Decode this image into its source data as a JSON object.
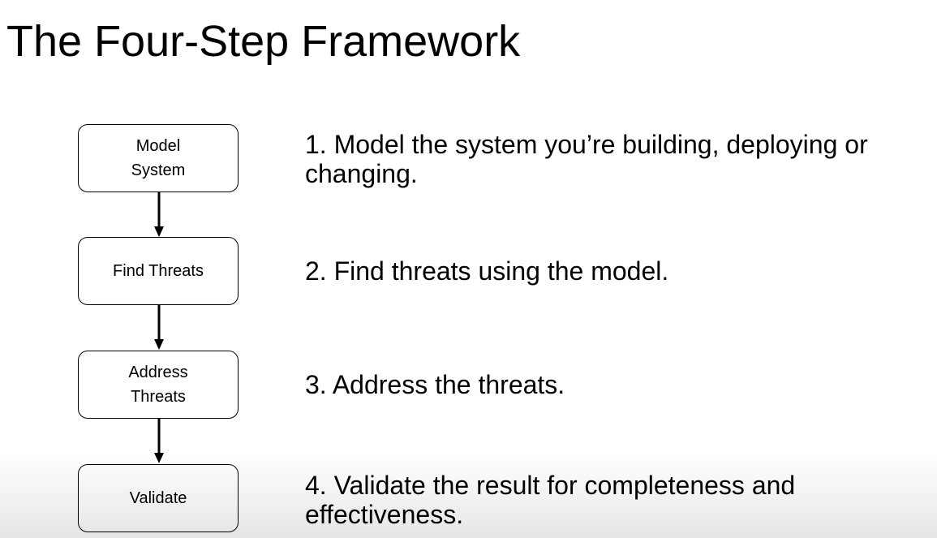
{
  "slide": {
    "title": "The Four-Step Framework"
  },
  "flowchart": {
    "boxes": [
      {
        "label": "Model System"
      },
      {
        "label": "Find Threats"
      },
      {
        "label": "Address Threats"
      },
      {
        "label": "Validate"
      }
    ]
  },
  "steps": [
    {
      "line1": "1. Model the system you’re building, deploying or",
      "line2": "changing."
    },
    {
      "line1": "2. Find threats using the model.",
      "line2": ""
    },
    {
      "line1": "3. Address the threats.",
      "line2": ""
    },
    {
      "line1": "4. Validate the result for completeness and",
      "line2": "effectiveness."
    }
  ],
  "colors": {
    "background": "#ffffff",
    "text": "#000000",
    "stroke": "#000000"
  }
}
